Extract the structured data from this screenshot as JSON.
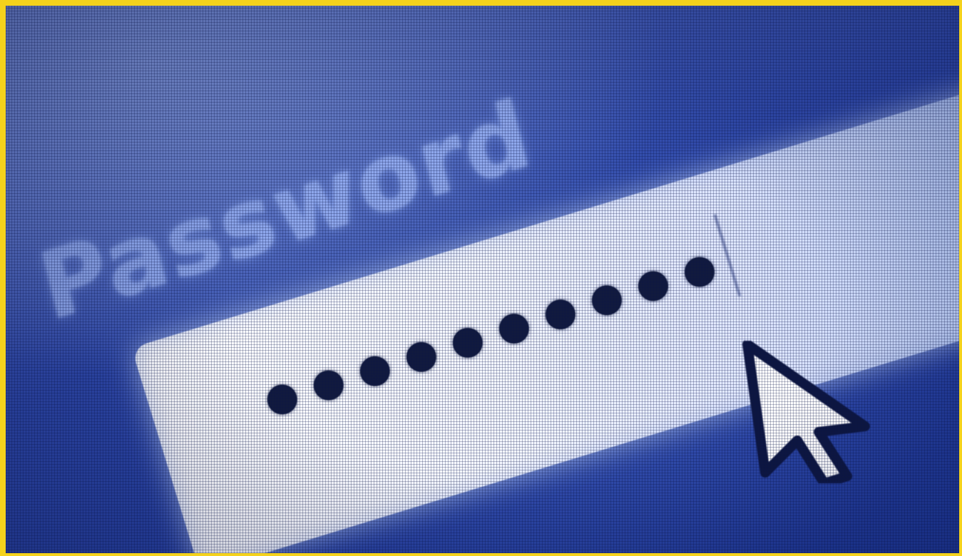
{
  "scene": {
    "label_text": "Password",
    "masked_value": "●●●●●●●●●●",
    "masked_length": 10
  },
  "colors": {
    "border": "#f4d21c",
    "screen_blue": "#2d47a8",
    "label_blue": "#8ea7ec",
    "field_white": "#ffffff",
    "dot_navy": "#111a3e"
  },
  "icons": {
    "cursor": "mouse-pointer-arrow-icon"
  }
}
